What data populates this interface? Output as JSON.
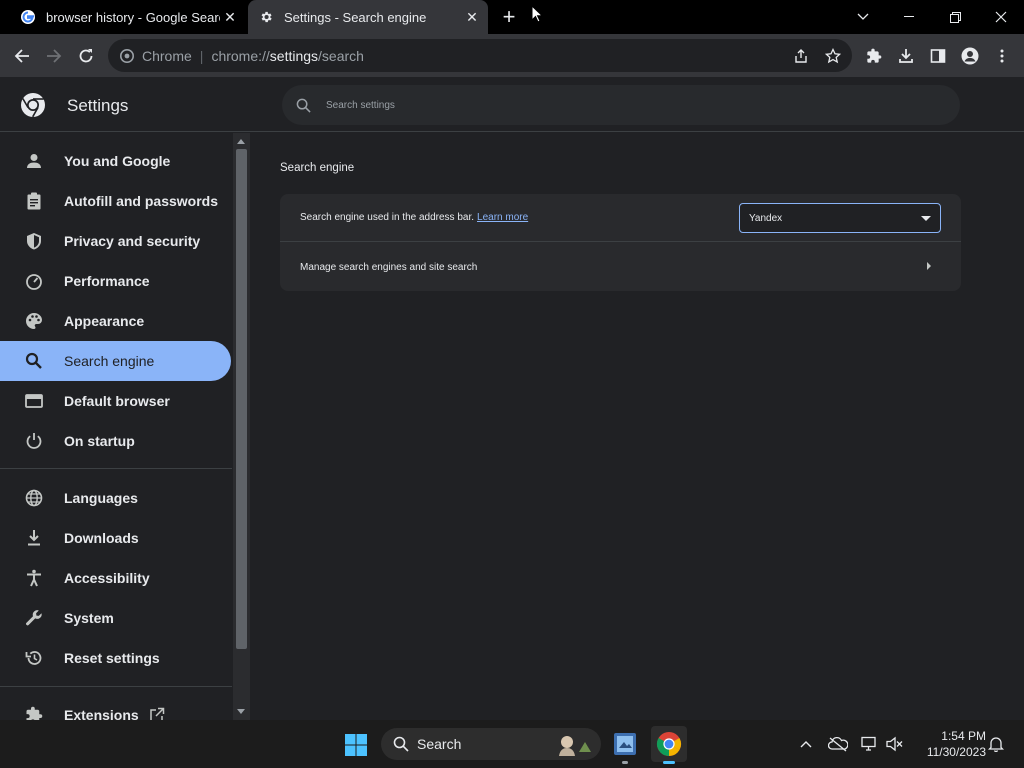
{
  "browser": {
    "tabs": [
      {
        "title": "browser history - Google Search",
        "icon": "google-g-icon",
        "active": false
      },
      {
        "title": "Settings - Search engine",
        "icon": "gear-icon",
        "active": true
      }
    ],
    "omnibox": {
      "site_label": "Chrome",
      "url_scheme": "chrome://",
      "url_host": "settings",
      "url_path": "/search"
    }
  },
  "settings": {
    "title": "Settings",
    "search_placeholder": "Search settings",
    "nav": [
      {
        "label": "You and Google",
        "icon": "person-icon"
      },
      {
        "label": "Autofill and passwords",
        "icon": "clipboard-icon"
      },
      {
        "label": "Privacy and security",
        "icon": "shield-icon"
      },
      {
        "label": "Performance",
        "icon": "speedometer-icon"
      },
      {
        "label": "Appearance",
        "icon": "palette-icon"
      },
      {
        "label": "Search engine",
        "icon": "search-icon",
        "active": true
      },
      {
        "label": "Default browser",
        "icon": "browser-window-icon"
      },
      {
        "label": "On startup",
        "icon": "power-icon"
      },
      {
        "label": "Languages",
        "icon": "globe-icon"
      },
      {
        "label": "Downloads",
        "icon": "download-icon"
      },
      {
        "label": "Accessibility",
        "icon": "accessibility-icon"
      },
      {
        "label": "System",
        "icon": "wrench-icon"
      },
      {
        "label": "Reset settings",
        "icon": "reset-history-icon"
      },
      {
        "label": "Extensions",
        "icon": "puzzle-icon"
      }
    ],
    "section": {
      "title": "Search engine",
      "address_bar_label": "Search engine used in the address bar.",
      "learn_more": "Learn more",
      "selected_engine": "Yandex",
      "manage_label": "Manage search engines and site search"
    }
  },
  "taskbar": {
    "search_label": "Search",
    "time": "1:54 PM",
    "date": "11/30/2023"
  },
  "colors": {
    "accent": "#8ab4f8",
    "background": "#202124",
    "card": "#292a2d"
  }
}
